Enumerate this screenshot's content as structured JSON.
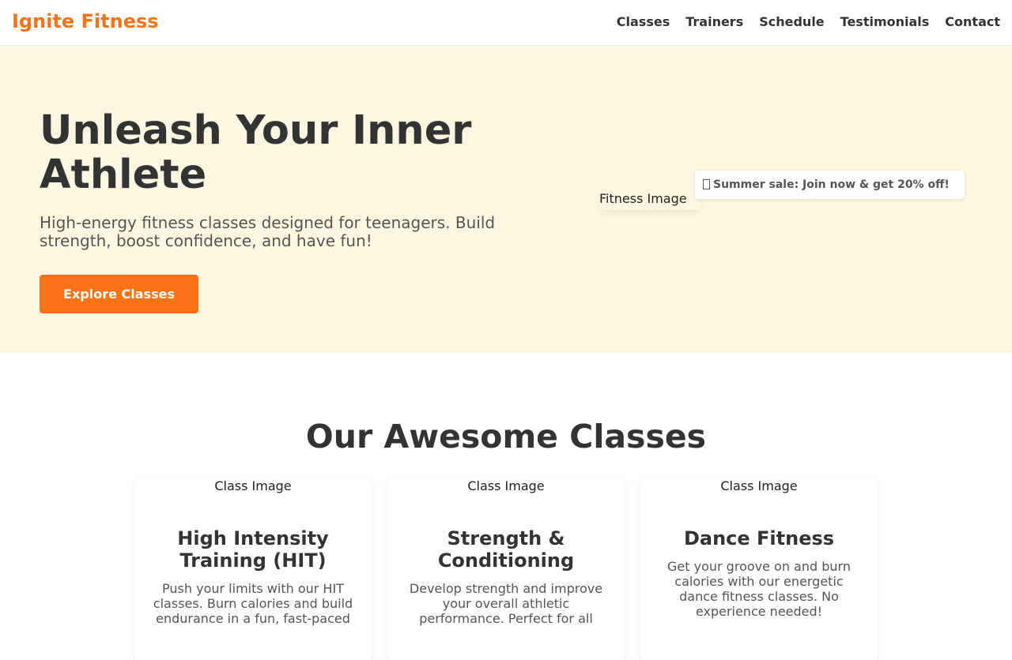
{
  "header": {
    "brand": "Ignite Fitness",
    "nav": [
      {
        "label": "Classes"
      },
      {
        "label": "Trainers"
      },
      {
        "label": "Schedule"
      },
      {
        "label": "Testimonials"
      },
      {
        "label": "Contact"
      }
    ]
  },
  "hero": {
    "title": "Unleash Your Inner Athlete",
    "subtitle": "High-energy fitness classes designed for teenagers. Build strength, boost confidence, and have fun!",
    "cta_label": "Explore Classes",
    "image_alt": "Fitness Image",
    "promo_text": "Summer sale: Join now & get 20% off!",
    "promo_icon": "missing-glyph-icon"
  },
  "classes": {
    "title": "Our Awesome Classes",
    "cards": [
      {
        "image_alt": "Class Image",
        "title": "High Intensity Training (HIT)",
        "description": "Push your limits with our HIT classes. Burn calories and build endurance in a fun, fast-paced"
      },
      {
        "image_alt": "Class Image",
        "title": "Strength & Conditioning",
        "description": "Develop strength and improve your overall athletic performance. Perfect for all"
      },
      {
        "image_alt": "Class Image",
        "title": "Dance Fitness",
        "description": "Get your groove on and burn calories with our energetic dance fitness classes. No experience needed!"
      }
    ]
  },
  "colors": {
    "accent": "#f97316",
    "hero_bg": "#fdf6e0",
    "text": "#333333"
  }
}
